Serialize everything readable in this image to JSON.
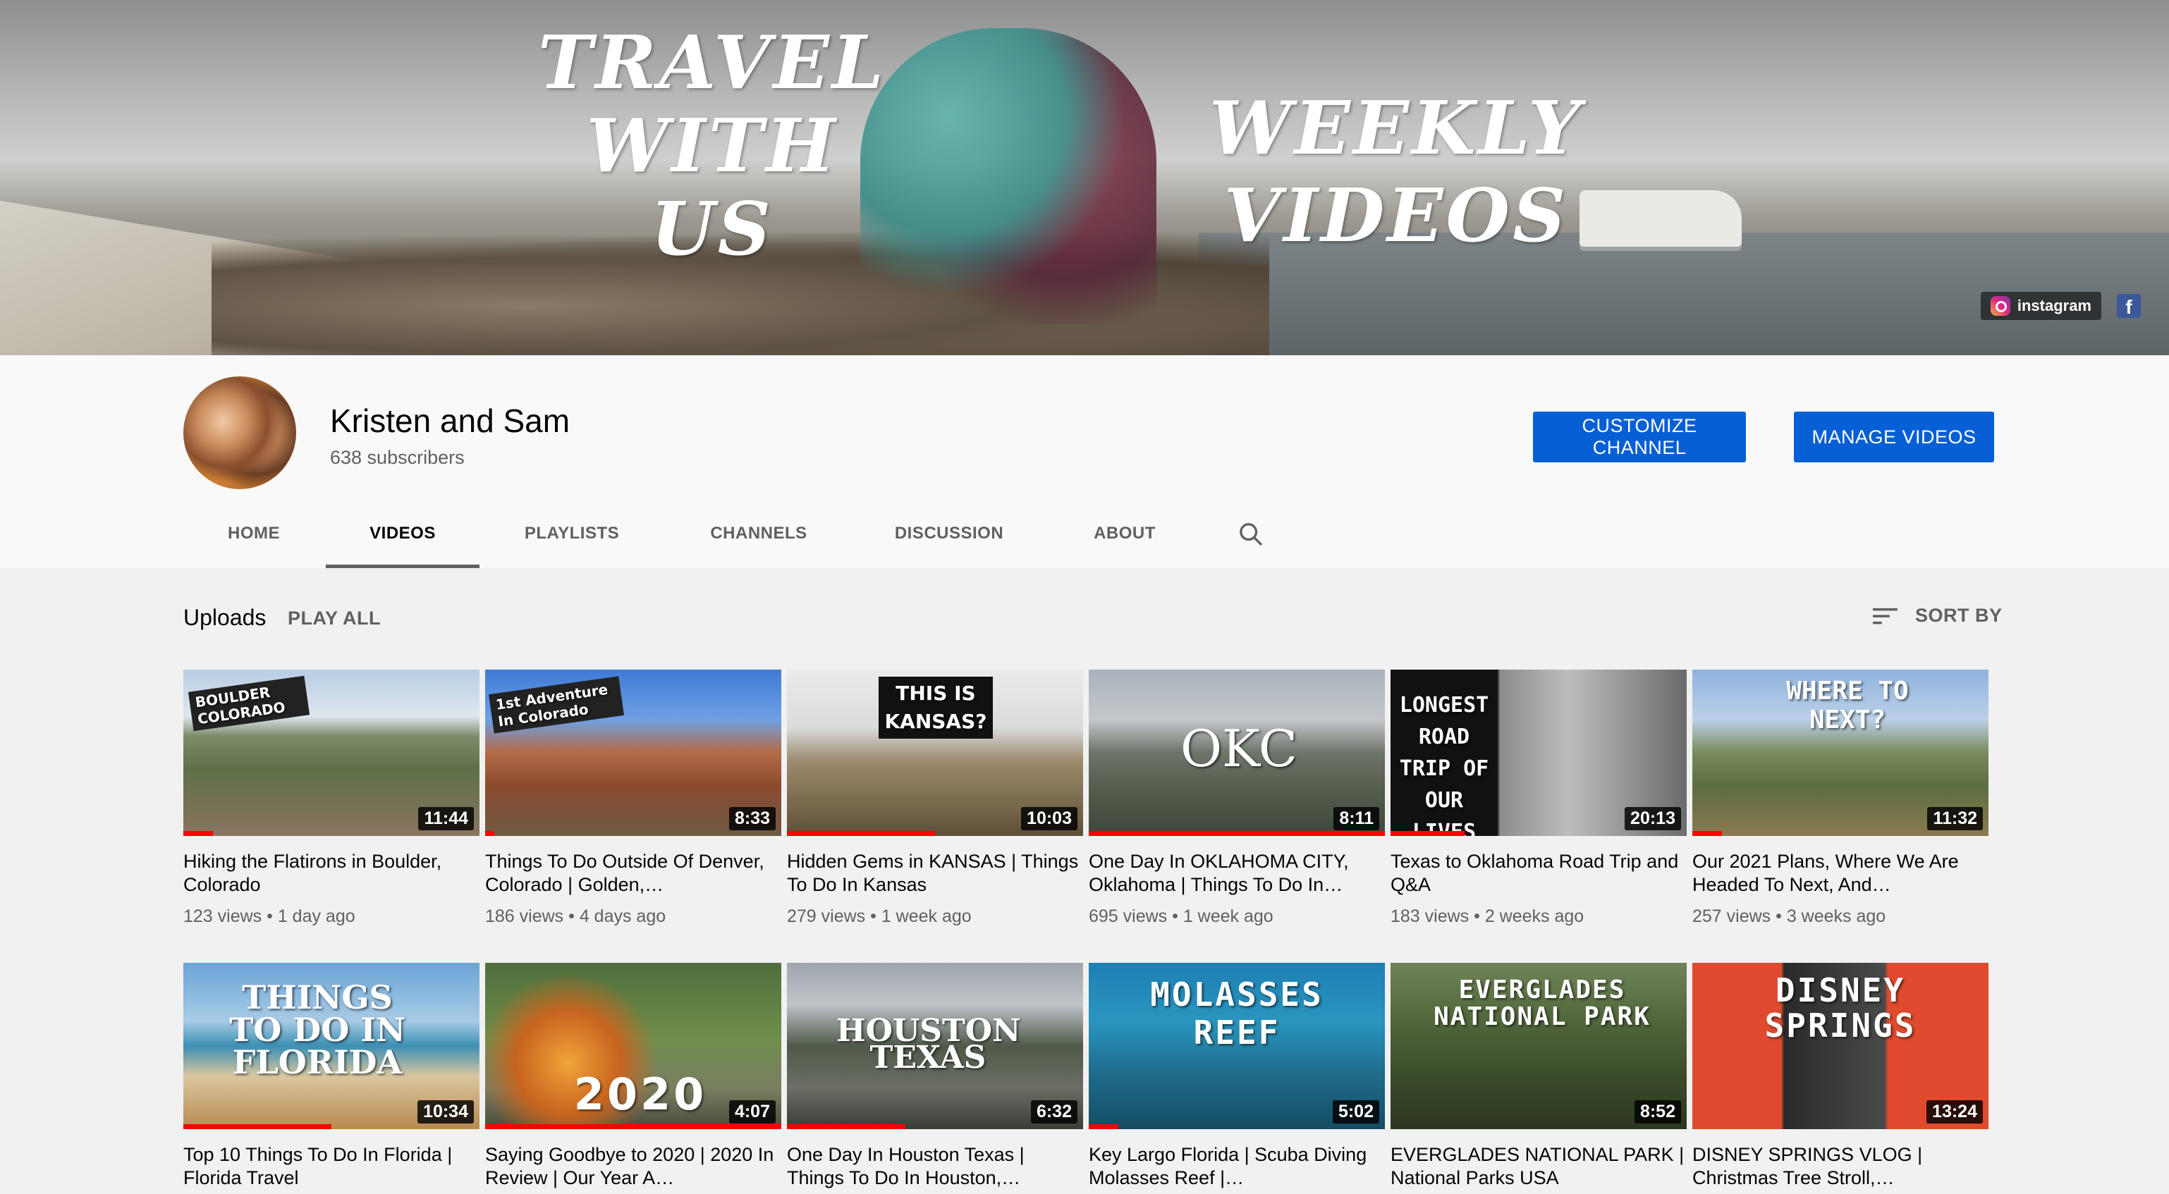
{
  "banner": {
    "left_text": "TRAVEL WITH US",
    "right_text": "WEEKLY VIDEOS",
    "social": {
      "instagram_label": "instagram",
      "facebook_icon": "facebook-icon"
    }
  },
  "channel": {
    "name": "Kristen and Sam",
    "subscribers": "638 subscribers",
    "buttons": {
      "customize": "CUSTOMIZE CHANNEL",
      "manage": "MANAGE VIDEOS"
    },
    "accent_color": "#065fd4"
  },
  "tabs": [
    {
      "label": "HOME"
    },
    {
      "label": "VIDEOS",
      "active": true
    },
    {
      "label": "PLAYLISTS"
    },
    {
      "label": "CHANNELS"
    },
    {
      "label": "DISCUSSION"
    },
    {
      "label": "ABOUT"
    }
  ],
  "uploads": {
    "title": "Uploads",
    "play_all": "PLAY ALL",
    "sort_by": "SORT BY"
  },
  "videos": [
    {
      "title": "Hiking the Flatirons in Boulder, Colorado",
      "views": "123 views",
      "age": "1 day ago",
      "duration": "11:44",
      "thumb_text": "BOULDER COLORADO",
      "watched": 0.1
    },
    {
      "title": "Things To Do Outside Of Denver, Colorado | Golden,…",
      "views": "186 views",
      "age": "4 days ago",
      "duration": "8:33",
      "thumb_text": "1st Adventure In Colorado",
      "watched": 0.03
    },
    {
      "title": "Hidden Gems in KANSAS | Things To Do In Kansas",
      "views": "279 views",
      "age": "1 week ago",
      "duration": "10:03",
      "thumb_text": "THIS IS KANSAS?",
      "watched": 0.5
    },
    {
      "title": "One Day In OKLAHOMA CITY, Oklahoma | Things To Do In…",
      "views": "695 views",
      "age": "1 week ago",
      "duration": "8:11",
      "thumb_text": "OKC",
      "watched": 1.0
    },
    {
      "title": "Texas to Oklahoma Road Trip and Q&A",
      "views": "183 views",
      "age": "2 weeks ago",
      "duration": "20:13",
      "thumb_text": "LONGEST ROAD TRIP OF OUR LIVES",
      "watched": 0.25
    },
    {
      "title": "Our 2021 Plans, Where We Are Headed To Next, And…",
      "views": "257 views",
      "age": "3 weeks ago",
      "duration": "11:32",
      "thumb_text": "WHERE TO NEXT?",
      "watched": 0.1
    },
    {
      "title": "Top 10 Things To Do In Florida | Florida Travel",
      "views": "",
      "age": "",
      "duration": "10:34",
      "thumb_text": "THINGS TO DO IN FLORIDA",
      "watched": 0.5
    },
    {
      "title": "Saying Goodbye to 2020 | 2020 In Review | Our Year A…",
      "views": "",
      "age": "",
      "duration": "4:07",
      "thumb_text": "2020",
      "watched": 1.0
    },
    {
      "title": "One Day In Houston Texas | Things To Do In Houston,…",
      "views": "",
      "age": "",
      "duration": "6:32",
      "thumb_text": "HOUSTON TEXAS",
      "watched": 0.4
    },
    {
      "title": "Key Largo Florida | Scuba Diving Molasses Reef |…",
      "views": "",
      "age": "",
      "duration": "5:02",
      "thumb_text": "MOLASSES REEF",
      "watched": 0.1
    },
    {
      "title": "EVERGLADES NATIONAL PARK | National Parks USA",
      "views": "",
      "age": "",
      "duration": "8:52",
      "thumb_text": "EVERGLADES NATIONAL PARK",
      "watched": 0.0
    },
    {
      "title": "DISNEY SPRINGS VLOG | Christmas Tree Stroll,…",
      "views": "",
      "age": "",
      "duration": "13:24",
      "thumb_text": "DISNEY SPRINGS",
      "watched": 0.0
    }
  ],
  "colors": {
    "progress": "#ff0000",
    "button": "#065fd4",
    "text_secondary": "#606060"
  }
}
